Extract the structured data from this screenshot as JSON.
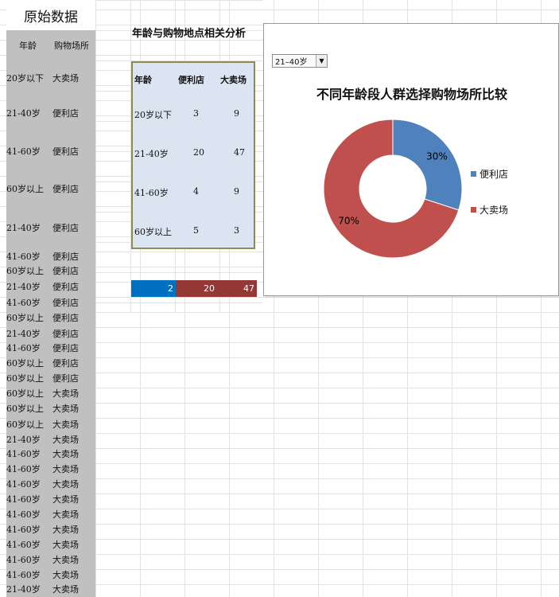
{
  "raw_title": "原始数据",
  "raw_headers": [
    "年龄",
    "购物场所"
  ],
  "raw_rows": [
    [
      "20岁以下",
      "大卖场"
    ],
    [
      "21-40岁",
      "便利店"
    ],
    [
      "41-60岁",
      "便利店"
    ],
    [
      "60岁以上",
      "便利店"
    ],
    [
      "21-40岁",
      "便利店"
    ],
    [
      "41-60岁",
      "便利店"
    ],
    [
      "60岁以上",
      "便利店"
    ],
    [
      "21-40岁",
      "便利店"
    ],
    [
      "41-60岁",
      "便利店"
    ],
    [
      "60岁以上",
      "便利店"
    ],
    [
      "21-40岁",
      "便利店"
    ],
    [
      "41-60岁",
      "便利店"
    ],
    [
      "60岁以上",
      "便利店"
    ],
    [
      "60岁以上",
      "便利店"
    ],
    [
      "60岁以上",
      "大卖场"
    ],
    [
      "60岁以上",
      "大卖场"
    ],
    [
      "60岁以上",
      "大卖场"
    ],
    [
      "21-40岁",
      "大卖场"
    ],
    [
      "41-60岁",
      "大卖场"
    ],
    [
      "41-60岁",
      "大卖场"
    ],
    [
      "41-60岁",
      "大卖场"
    ],
    [
      "41-60岁",
      "大卖场"
    ],
    [
      "41-60岁",
      "大卖场"
    ],
    [
      "41-60岁",
      "大卖场"
    ],
    [
      "41-60岁",
      "大卖场"
    ],
    [
      "41-60岁",
      "大卖场"
    ],
    [
      "41-60岁",
      "大卖场"
    ],
    [
      "21-40岁",
      "大卖场"
    ]
  ],
  "analysis_title": "年龄与购物地点相关分析",
  "pivot": {
    "headers": [
      "年龄",
      "便利店",
      "大卖场"
    ],
    "rows": [
      [
        "20岁以下",
        "3",
        "9"
      ],
      [
        "21-40岁",
        "20",
        "47"
      ],
      [
        "41-60岁",
        "4",
        "9"
      ],
      [
        "60岁以上",
        "5",
        "3"
      ]
    ]
  },
  "helper_row": [
    "2",
    "20",
    "47"
  ],
  "colors": {
    "convenience": "#4f81bd",
    "supermarket": "#c0504d",
    "helper_blue": "#0070c0",
    "helper_red": "#953735"
  },
  "chart": {
    "selector_value": "21–40岁",
    "title": "不同年龄段人群选择购物场所比较",
    "legend": [
      "便利店",
      "大卖场"
    ]
  },
  "chart_data": {
    "type": "pie",
    "categories": [
      "便利店",
      "大卖场"
    ],
    "values": [
      30,
      70
    ],
    "data_labels": [
      "30%",
      "70%"
    ],
    "legend_position": "right"
  }
}
